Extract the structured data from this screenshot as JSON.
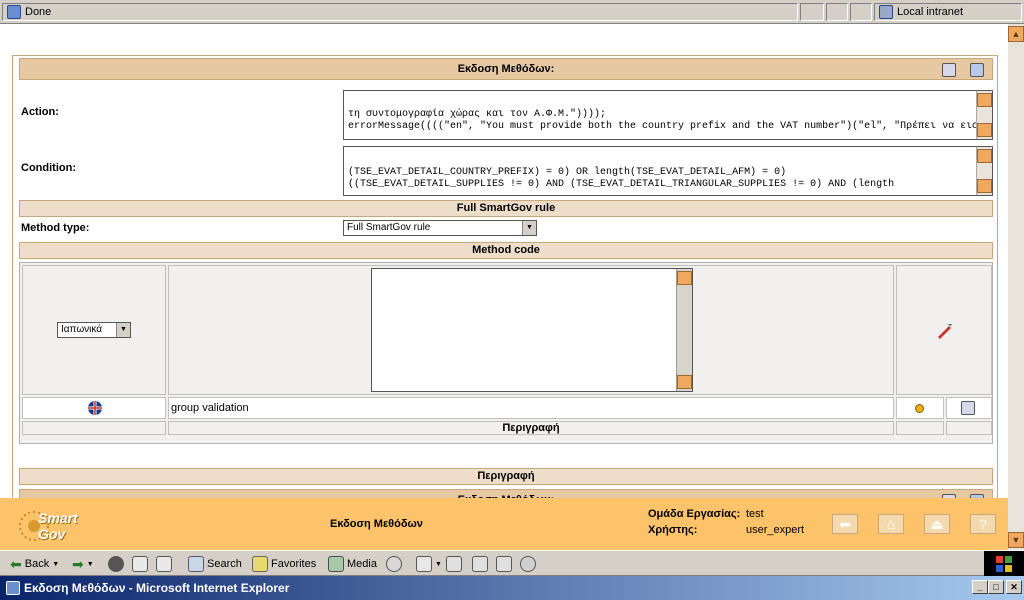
{
  "status_bar": {
    "status_text": "Done",
    "zone_text": "Local intranet"
  },
  "form": {
    "header_title": "Εκδοση Μεθόδων:",
    "action_label": "Action:",
    "action_text_line1": "errorMessage((((\"en\", \"You must provide both the country prefix and the VAT number\")(\"el\", \"Πρέπει να εισάγετε",
    "action_text_line2": "τη συντομογραφία χώρας και τον Α.Φ.Μ.\"))));",
    "condition_label": "Condition:",
    "condition_text_line1": "((TSE_EVAT_DETAIL_SUPPLIES != 0) AND (TSE_EVAT_DETAIL_TRIANGULAR_SUPPLIES != 0) AND (length",
    "condition_text_line2": "(TSE_EVAT_DETAIL_COUNTRY_PREFIX) = 0) OR length(TSE_EVAT_DETAIL_AFM) = 0)",
    "rule_band": "Full SmartGov rule",
    "method_type_label": "Method type:",
    "method_type_value": "Full SmartGov rule",
    "method_code_band": "Method code",
    "language_value": "Ιαπωνικά",
    "description_text": "group validation",
    "description_header": "Περιγραφή",
    "description_band": "Περιγραφή",
    "footer_header_title": "Εκδοση Μεθόδων:"
  },
  "footer": {
    "logo_text": "Smart Gov",
    "page_title": "Εκδοση Μεθόδων",
    "workgroup_label": "Ομάδα Εργασίας:",
    "workgroup_value": "test",
    "user_label": "Χρήστης:",
    "user_value": "user_expert"
  },
  "toolbar": {
    "back_label": "Back",
    "search_label": "Search",
    "favorites_label": "Favorites",
    "media_label": "Media"
  },
  "window": {
    "title": "Εκδοση Μεθόδων - Microsoft Internet Explorer"
  },
  "colors": {
    "footer_bg": "#fcc36b",
    "band_bg": "#e6c9a3",
    "titlebar": "#0a246a"
  }
}
